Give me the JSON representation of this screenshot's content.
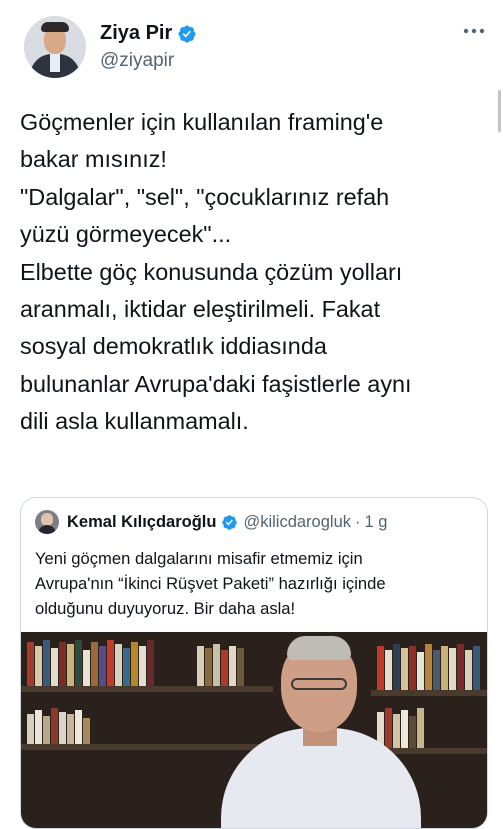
{
  "author": {
    "display_name": "Ziya Pir",
    "handle": "@ziyapir"
  },
  "tweet": {
    "lines": [
      "Göçmenler için kullanılan framing'e",
      "bakar mısınız!",
      "\"Dalgalar\", \"sel\", \"çocuklarınız refah",
      "yüzü görmeyecek\"...",
      "Elbette göç konusunda çözüm yolları",
      "aranmalı, iktidar eleştirilmeli. Fakat",
      "sosyal demokratlık iddiasında",
      "bulunanlar Avrupa'daki faşistlerle aynı",
      "dili asla kullanmamalı."
    ]
  },
  "quoted_tweet": {
    "display_name": "Kemal Kılıçdaroğlu",
    "handle": "@kilicdarogluk",
    "separator": "·",
    "time": "1 g",
    "lines": [
      "Yeni göçmen dalgalarını misafir etmemiz için",
      "Avrupa'nın “İkinci Rüşvet Paketi” hazırlığı içinde",
      "olduğunu duyuyoruz. Bir daha asla!"
    ]
  },
  "icons": {
    "verified": "verified-badge-icon",
    "more": "more-options-icon"
  },
  "colors": {
    "verified_blue": "#1d9bf0",
    "secondary_text": "#536471",
    "border": "#cfd9de"
  }
}
